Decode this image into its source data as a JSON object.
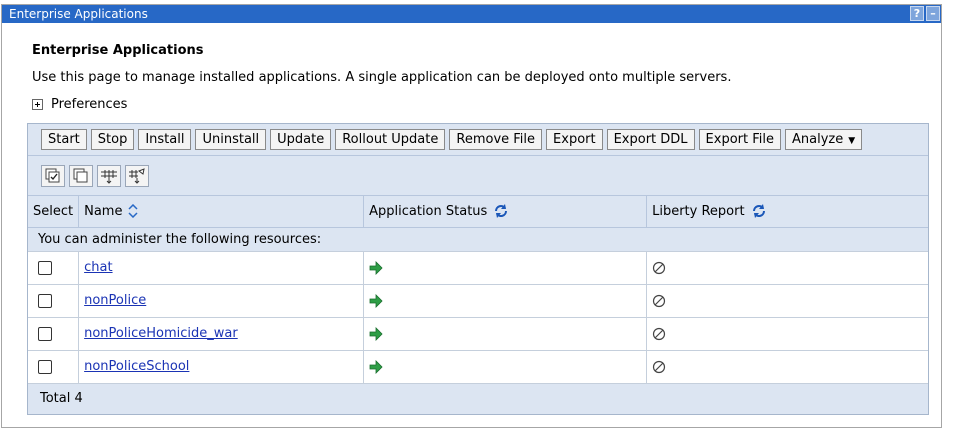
{
  "portlet": {
    "title": "Enterprise Applications",
    "help_label": "?",
    "minimize_label": "–"
  },
  "page": {
    "heading": "Enterprise Applications",
    "description": "Use this page to manage installed applications. A single application can be deployed onto multiple servers.",
    "preferences_label": "Preferences"
  },
  "toolbar": {
    "buttons": [
      "Start",
      "Stop",
      "Install",
      "Uninstall",
      "Update",
      "Rollout Update",
      "Remove File",
      "Export",
      "Export DDL",
      "Export File"
    ],
    "analyze_label": "Analyze",
    "icon_buttons": [
      "select-all-icon",
      "deselect-all-icon",
      "show-filter-icon",
      "clear-filter-icon"
    ]
  },
  "table": {
    "columns": {
      "select": "Select",
      "name": "Name",
      "status": "Application Status",
      "liberty": "Liberty Report"
    },
    "note": "You can administer the following resources:",
    "rows": [
      {
        "name": "chat",
        "status_icon": "started-arrow-icon",
        "liberty_icon": "not-applicable-icon"
      },
      {
        "name": "nonPolice",
        "status_icon": "started-arrow-icon",
        "liberty_icon": "not-applicable-icon"
      },
      {
        "name": "nonPoliceHomicide_war",
        "status_icon": "started-arrow-icon",
        "liberty_icon": "not-applicable-icon"
      },
      {
        "name": "nonPoliceSchool",
        "status_icon": "started-arrow-icon",
        "liberty_icon": "not-applicable-icon"
      }
    ],
    "total": "Total 4"
  },
  "colors": {
    "titlebar": "#2768c6",
    "header_bg": "#dce5f2",
    "link": "#1a33b4",
    "started_green": "#2e9e46"
  }
}
